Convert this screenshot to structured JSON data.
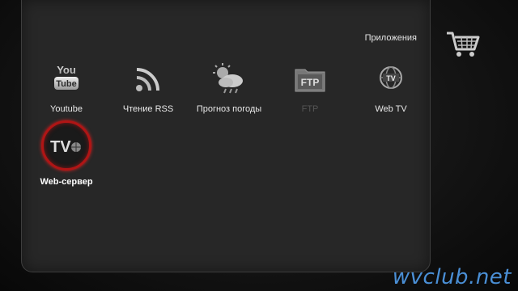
{
  "section_title": "Приложения",
  "apps": [
    {
      "label": "Youtube",
      "icon": "youtube-icon",
      "state": "normal"
    },
    {
      "label": "Чтение RSS",
      "icon": "rss-icon",
      "state": "normal"
    },
    {
      "label": "Прогноз погоды",
      "icon": "weather-icon",
      "state": "normal"
    },
    {
      "label": "FTP",
      "icon": "ftp-icon",
      "state": "disabled"
    },
    {
      "label": "Web TV",
      "icon": "web-tv-icon",
      "state": "normal"
    },
    {
      "label": "Web-сервер",
      "icon": "web-server-icon",
      "state": "selected"
    }
  ],
  "cart_icon": "shopping-cart-icon",
  "watermark": "wvclub.net",
  "colors": {
    "selection_ring": "#b01515",
    "watermark": "#4a8fd6",
    "panel": "#272727"
  }
}
